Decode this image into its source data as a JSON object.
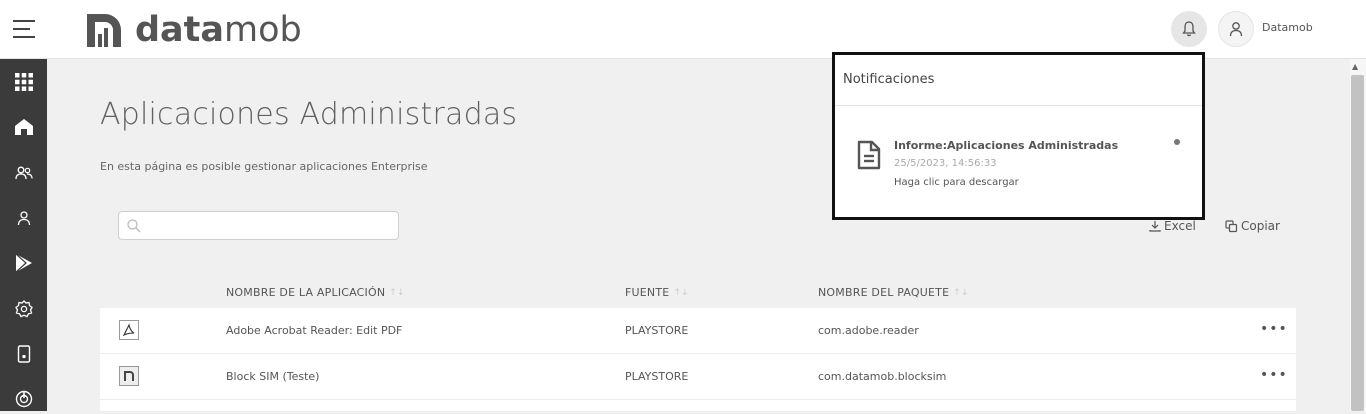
{
  "header": {
    "logo_text_bold": "data",
    "logo_text_light": "mob",
    "user_name": "Datamob",
    "icons": {
      "menu": "hamburger-icon",
      "bell": "bell-icon",
      "user": "user-icon"
    }
  },
  "sidebar": {
    "items": [
      {
        "icon": "apps-grid-icon"
      },
      {
        "icon": "home-icon"
      },
      {
        "icon": "users-icon"
      },
      {
        "icon": "user-icon"
      },
      {
        "icon": "play-store-icon"
      },
      {
        "icon": "settings-icon"
      },
      {
        "icon": "device-icon"
      },
      {
        "icon": "power-icon"
      }
    ]
  },
  "page": {
    "title": "Aplicaciones Administradas",
    "subtitle": "En esta página es posible gestionar aplicaciones Enterprise",
    "search_placeholder": ""
  },
  "toolbar": {
    "excel_label": "Excel",
    "copy_label": "Copiar"
  },
  "table": {
    "columns": [
      "NOMBRE DE LA APLICACIÓN",
      "FUENTE",
      "NOMBRE DEL PAQUETE"
    ],
    "rows": [
      {
        "name": "Adobe Acrobat Reader: Edit PDF",
        "source": "PLAYSTORE",
        "package": "com.adobe.reader",
        "more": "•••"
      },
      {
        "name": "Block SIM (Teste)",
        "source": "PLAYSTORE",
        "package": "com.datamob.blocksim",
        "more": "•••"
      }
    ]
  },
  "notifications": {
    "title": "Notificaciones",
    "items": [
      {
        "title": "Informe:Aplicaciones Administradas",
        "time": "25/5/2023, 14:56:33",
        "message": "Haga clic para descargar",
        "icon": "document-icon"
      }
    ]
  },
  "colors": {
    "sidebar_bg": "#3b3b3b",
    "page_bg": "#f0f0f0",
    "popup_border": "#111111"
  }
}
